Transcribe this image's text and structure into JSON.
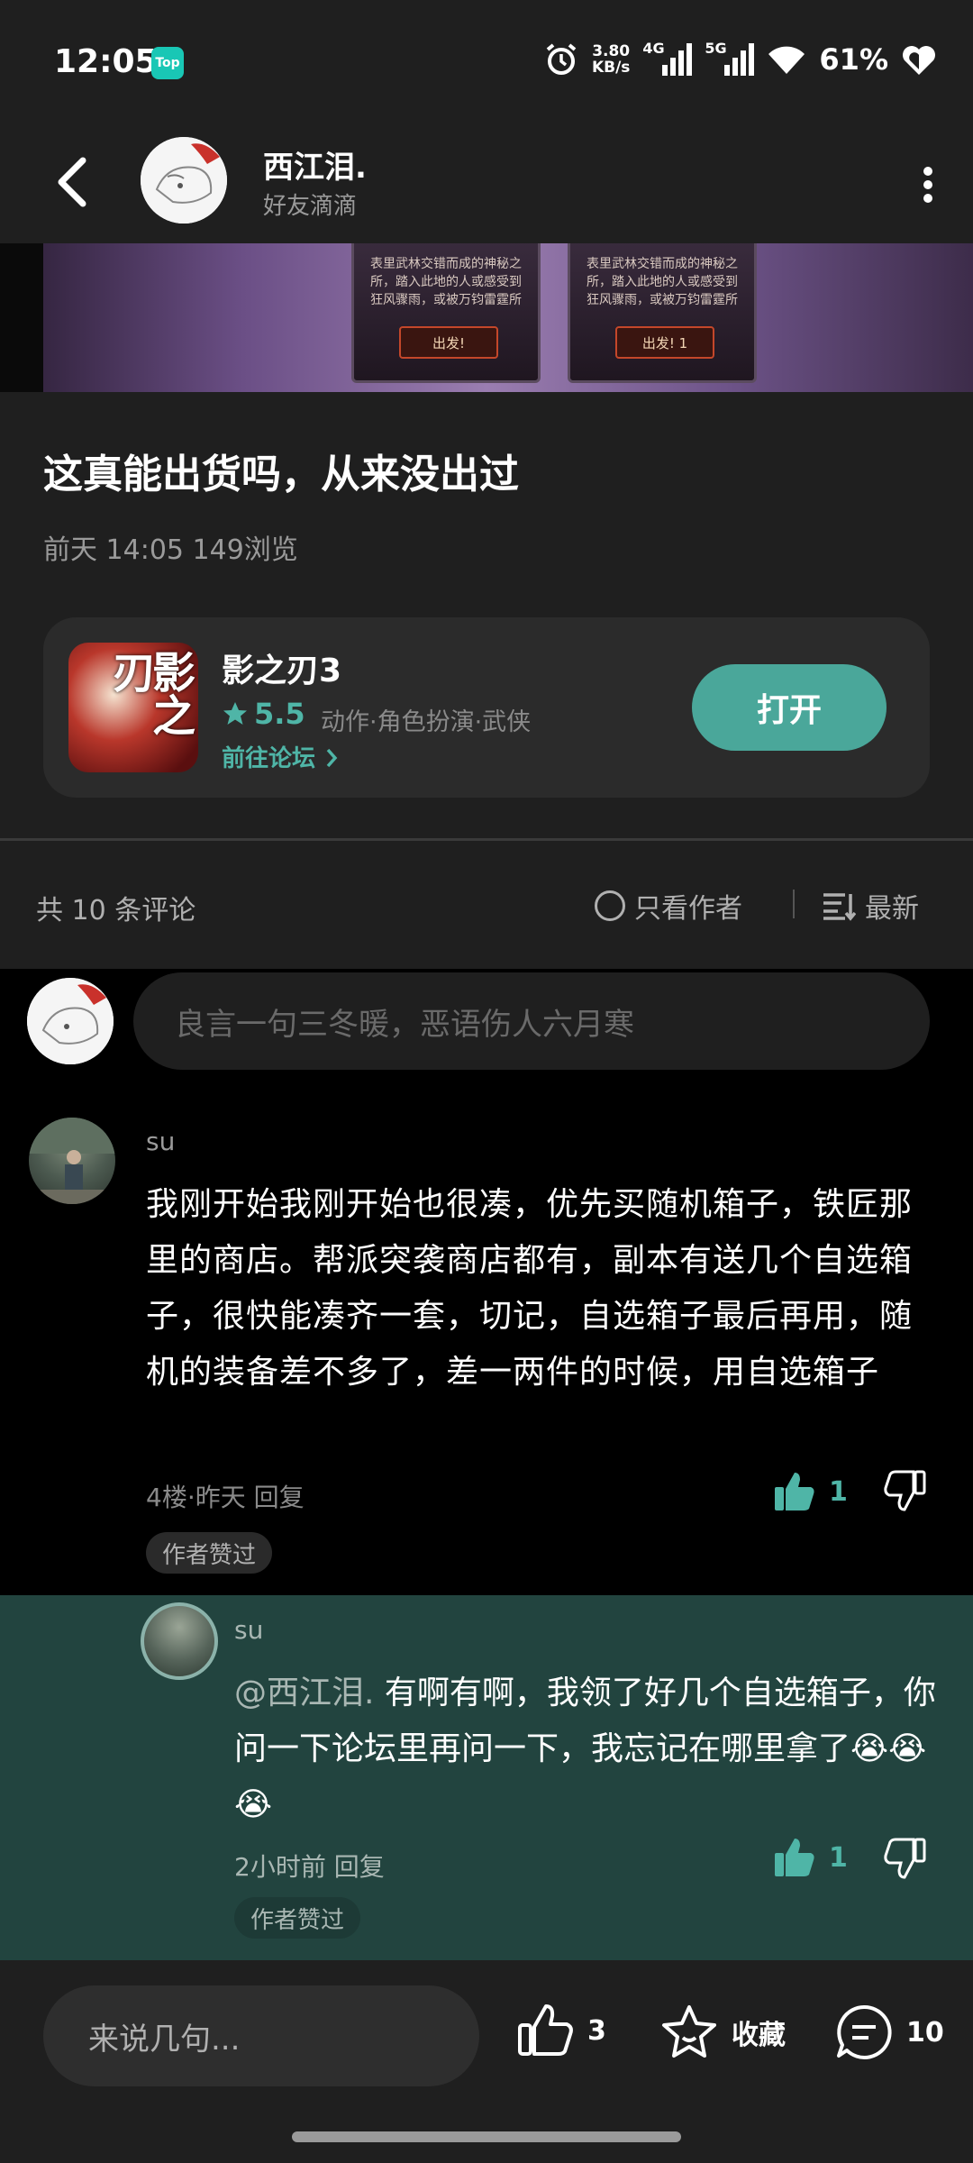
{
  "status_bar": {
    "time": "12:05",
    "app_badge": "Top",
    "speed_value": "3.80",
    "speed_unit": "KB/s",
    "net1": "4G",
    "net2": "5G",
    "battery": "61%"
  },
  "header": {
    "name": "西江泪.",
    "subtitle": "好友滴滴"
  },
  "banner": {
    "card_text": "表里武林交错而成的神秘之所，踏入此地的人或感受到狂风骤雨，或被万钧雷霆所",
    "card1_button": "出发!",
    "card2_button": "出发! 1"
  },
  "post": {
    "title": "这真能出货吗，从来没出过",
    "meta": "前天 14:05  149浏览"
  },
  "game": {
    "name": "影之刃3",
    "icon_text": "影之刃",
    "rating": "5.5",
    "tags": "动作·角色扮演·武侠",
    "forum_link": "前往论坛",
    "open_button": "打开"
  },
  "comments_bar": {
    "count": "共 10 条评论",
    "only_author": "只看作者",
    "sort": "最新"
  },
  "comment_input": {
    "placeholder": "良言一句三冬暖，恶语伤人六月寒"
  },
  "comments": [
    {
      "user": "su",
      "text": "我刚开始我刚开始也很凑，优先买随机箱子，铁匠那里的商店。帮派突袭商店都有，副本有送几个自选箱子，很快能凑齐一套，切记，自选箱子最后再用，随机的装备差不多了，差一两件的时候，用自选箱子",
      "meta": "4楼·昨天  回复",
      "likes": "1",
      "badge": "作者赞过"
    }
  ],
  "reply": {
    "user": "su",
    "mention": "@西江泪.",
    "text": " 有啊有啊，我领了好几个自选箱子，你问一下论坛里再问一下，我忘记在哪里拿了😭😭😭",
    "meta": "2小时前  回复",
    "likes": "1",
    "badge": "作者赞过"
  },
  "bottom_bar": {
    "input_placeholder": "来说几句...",
    "likes": "3",
    "favorite_label": "收藏",
    "comments": "10"
  },
  "colors": {
    "accent": "#4fb5a7",
    "open_button": "#4aa79a",
    "reply_bg": "#22443f"
  }
}
